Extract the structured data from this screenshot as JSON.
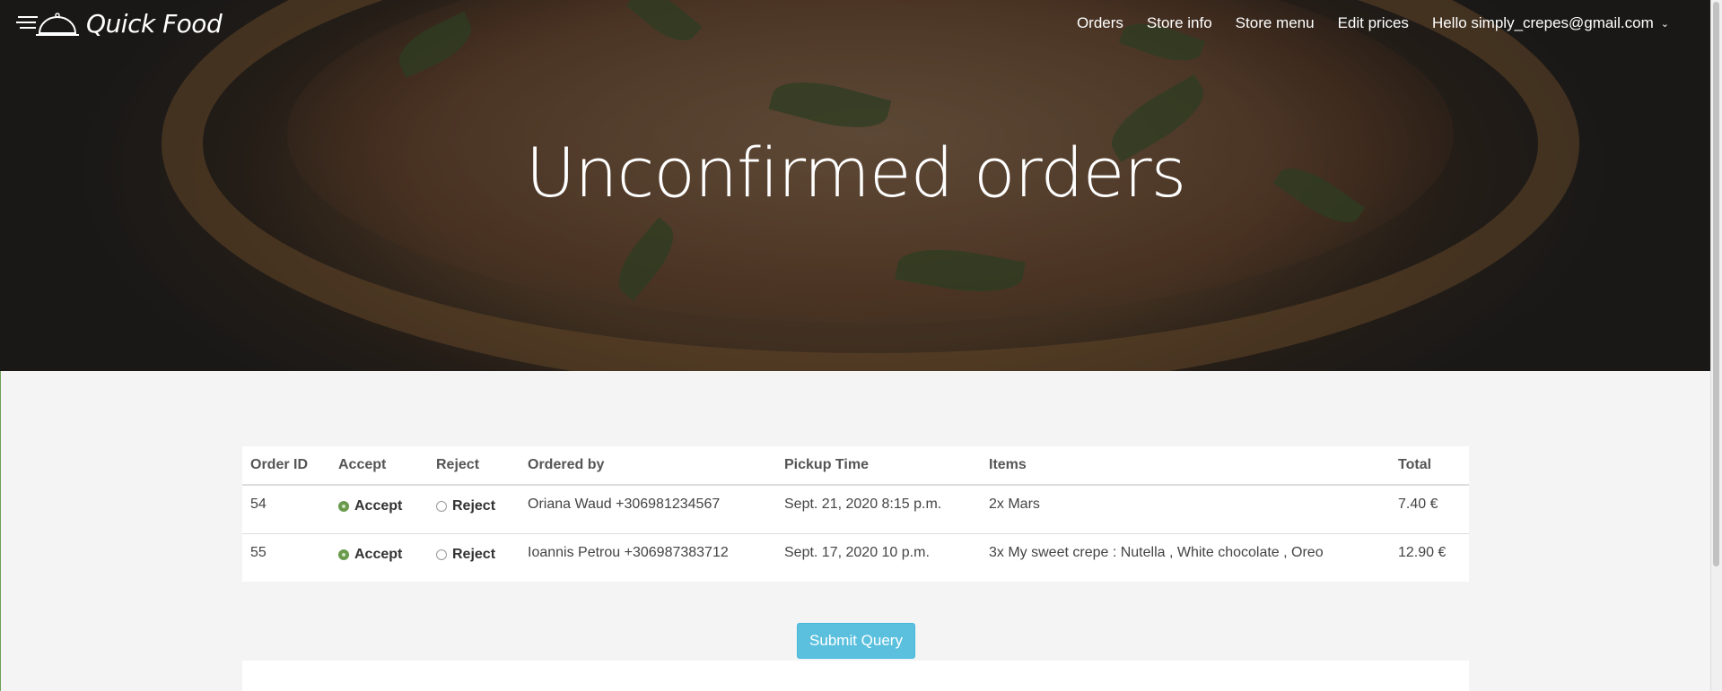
{
  "brand": {
    "name": "Quick Food",
    "logo_icon": "cloche-icon"
  },
  "nav": {
    "orders": "Orders",
    "store_info": "Store info",
    "store_menu": "Store menu",
    "edit_prices": "Edit prices",
    "user_greeting": "Hello simply_crepes@gmail.com",
    "user_caret": "⌄"
  },
  "hero": {
    "title": "Unconfirmed orders"
  },
  "table": {
    "headers": {
      "order_id": "Order ID",
      "accept": "Accept",
      "reject": "Reject",
      "ordered_by": "Ordered by",
      "pickup_time": "Pickup Time",
      "items": "Items",
      "total": "Total"
    },
    "rows": [
      {
        "order_id": "54",
        "accept_label": "Accept",
        "reject_label": "Reject",
        "selected": "accept",
        "ordered_by": "Oriana Waud +306981234567",
        "pickup_time": "Sept. 21, 2020 8:15 p.m.",
        "items": "2x Mars",
        "total": "7.40 €"
      },
      {
        "order_id": "55",
        "accept_label": "Accept",
        "reject_label": "Reject",
        "selected": "accept",
        "ordered_by": "Ioannis Petrou +306987383712",
        "pickup_time": "Sept. 17, 2020 10 p.m.",
        "items": "3x My sweet crepe : Nutella , White chocolate , Oreo",
        "total": "12.90 €"
      }
    ]
  },
  "submit": {
    "label": "Submit Query"
  },
  "colors": {
    "accent_button": "#5bc0de",
    "radio_checked": "#6a9a4c",
    "page_background": "#f4f4f4"
  }
}
